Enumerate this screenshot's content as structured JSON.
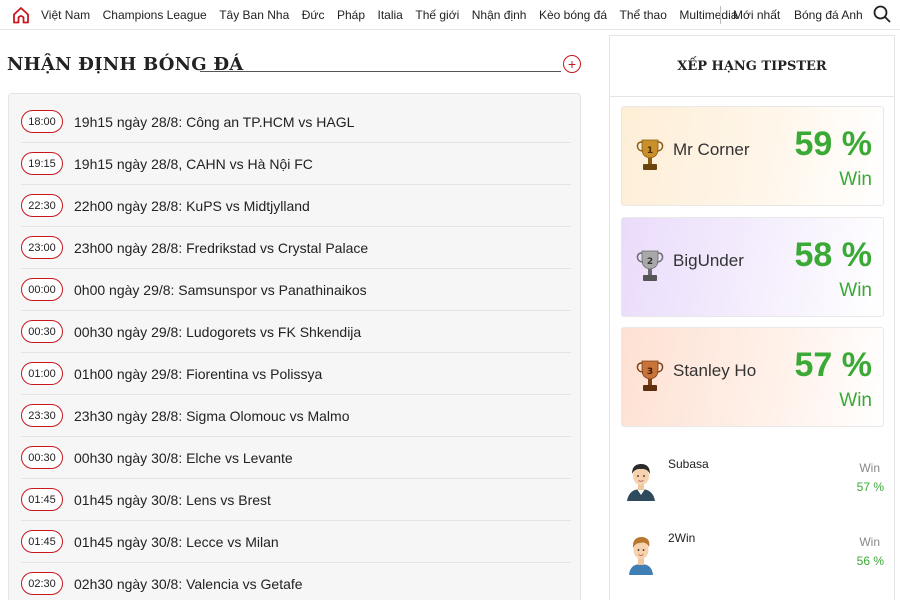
{
  "nav": {
    "items": [
      "Việt Nam",
      "Champions League",
      "Tây Ban Nha",
      "Đức",
      "Pháp",
      "Italia",
      "Thế giới",
      "Nhận định",
      "Kèo bóng đá",
      "Thể thao",
      "Multimedia"
    ],
    "latest": "Mới nhất",
    "england": "Bóng đá Anh"
  },
  "section": {
    "title": "NHẬN ĐỊNH BÓNG ĐÁ",
    "plus": "+"
  },
  "matches": [
    {
      "time": "18:00",
      "title": "19h15 ngày 28/8: Công an TP.HCM vs HAGL"
    },
    {
      "time": "19:15",
      "title": "19h15 ngày 28/8, CAHN vs Hà Nội FC"
    },
    {
      "time": "22:30",
      "title": "22h00 ngày 28/8: KuPS vs Midtjylland"
    },
    {
      "time": "23:00",
      "title": "23h00 ngày 28/8: Fredrikstad vs Crystal Palace"
    },
    {
      "time": "00:00",
      "title": "0h00 ngày 29/8: Samsunspor vs Panathinaikos"
    },
    {
      "time": "00:30",
      "title": "00h30 ngày 29/8: Ludogorets vs FK Shkendija"
    },
    {
      "time": "01:00",
      "title": "01h00 ngày 29/8: Fiorentina vs Polissya"
    },
    {
      "time": "23:30",
      "title": "23h30 ngày 28/8: Sigma Olomouc vs Malmo"
    },
    {
      "time": "00:30",
      "title": "00h30 ngày 30/8: Elche vs Levante"
    },
    {
      "time": "01:45",
      "title": "01h45 ngày 30/8: Lens vs Brest"
    },
    {
      "time": "01:45",
      "title": "01h45 ngày 30/8: Lecce vs Milan"
    },
    {
      "time": "02:30",
      "title": "02h30 ngày 30/8: Valencia vs Getafe"
    }
  ],
  "tipster": {
    "heading": "XẾP HẠNG TIPSTER",
    "top": [
      {
        "rank": "1",
        "name": "Mr Corner",
        "percent": "59 %",
        "win": "Win",
        "trophy_color": "#b07a1e"
      },
      {
        "rank": "2",
        "name": "BigUnder",
        "percent": "58 %",
        "win": "Win",
        "trophy_color": "#8c8c8c"
      },
      {
        "rank": "3",
        "name": "Stanley Ho",
        "percent": "57 %",
        "win": "Win",
        "trophy_color": "#b8622b"
      }
    ],
    "others": [
      {
        "name": "Subasa",
        "win_label": "Win",
        "percent": "57 %"
      },
      {
        "name": "2Win",
        "win_label": "Win",
        "percent": "56 %"
      }
    ]
  },
  "colors": {
    "accent": "#c9171e",
    "win_green": "#3aa935"
  }
}
